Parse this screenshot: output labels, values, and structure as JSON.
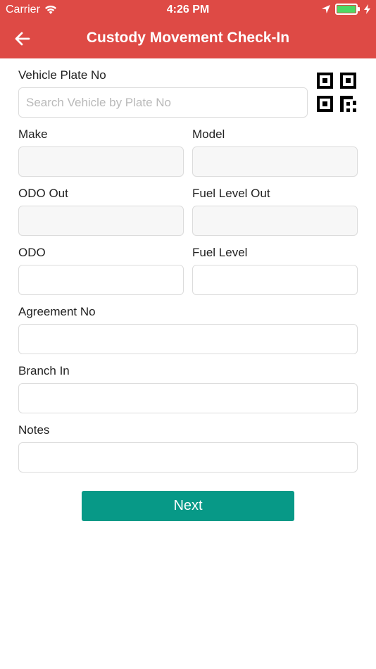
{
  "status_bar": {
    "carrier": "Carrier",
    "time": "4:26 PM",
    "battery_color": "#4cd964"
  },
  "header": {
    "title": "Custody Movement Check-In",
    "background": "#de4a45"
  },
  "form": {
    "vehicle_plate": {
      "label": "Vehicle Plate No",
      "placeholder": "Search Vehicle by Plate No",
      "value": ""
    },
    "make": {
      "label": "Make",
      "value": ""
    },
    "model": {
      "label": "Model",
      "value": ""
    },
    "odo_out": {
      "label": "ODO Out",
      "value": ""
    },
    "fuel_level_out": {
      "label": "Fuel Level Out",
      "value": ""
    },
    "odo": {
      "label": "ODO",
      "value": ""
    },
    "fuel_level": {
      "label": "Fuel Level",
      "value": ""
    },
    "agreement_no": {
      "label": "Agreement No",
      "value": ""
    },
    "branch_in": {
      "label": "Branch In",
      "value": ""
    },
    "notes": {
      "label": "Notes",
      "value": ""
    }
  },
  "actions": {
    "next_label": "Next",
    "next_color": "#079987"
  },
  "icons": {
    "back": "back-arrow-icon",
    "qr": "qr-code-icon",
    "wifi": "wifi-icon",
    "location": "location-arrow-icon",
    "battery": "battery-icon",
    "charging": "charging-bolt-icon"
  }
}
